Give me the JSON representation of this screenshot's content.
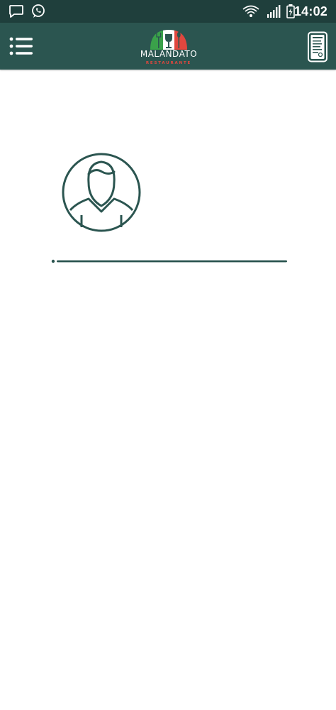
{
  "status_bar": {
    "time": "14:02",
    "left_icons": [
      "message-icon",
      "whatsapp-icon"
    ],
    "right_icons": [
      "wifi-icon",
      "signal-icon",
      "battery-charging-icon"
    ]
  },
  "app_bar": {
    "logo": {
      "name": "MALANDATO",
      "subtitle": "RESTAURANTE"
    },
    "left_icon": "hamburger-menu-icon",
    "right_icon": "menu-card-icon"
  },
  "content": {
    "avatar_icon": "user-avatar-icon"
  },
  "colors": {
    "status_bar": "#1f3f3c",
    "app_bar": "#2b5550",
    "accent": "#2b5550",
    "background": "#ffffff",
    "italy_green": "#3aa14a",
    "italy_red": "#e0473e"
  }
}
